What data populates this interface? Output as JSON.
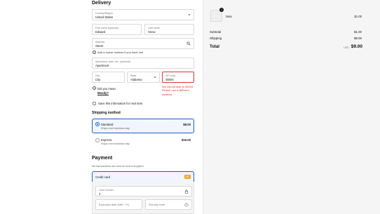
{
  "delivery": {
    "heading": "Delivery",
    "country": {
      "label": "Country/Region",
      "value": "United States"
    },
    "first_name": {
      "label": "First name (optional)",
      "value": "Edward"
    },
    "last_name": {
      "label": "Last name",
      "value": "Snow"
    },
    "address": {
      "label": "Address",
      "value": "Street"
    },
    "add_house_number": "Add a house number if you have one",
    "apartment": {
      "label": "Apartment, suite, etc. (optional)",
      "value": "Apartment"
    },
    "city": {
      "label": "City",
      "value": "City"
    },
    "state": {
      "label": "State",
      "value": "Alabama"
    },
    "zip": {
      "label": "ZIP code",
      "value": "35004"
    },
    "zip_error": "We cannot ship to 35004. Please use a different address.",
    "did_you_mean": "Did you mean",
    "suggestion": "Moody?",
    "save_info": "Save this information for next time"
  },
  "shipping": {
    "heading": "Shipping method",
    "options": [
      {
        "name": "Standard",
        "desc": "Ships next business day",
        "price": "$8.00",
        "selected": true
      },
      {
        "name": "Express",
        "desc": "Ships next business day",
        "price": "$15.00",
        "selected": false
      }
    ]
  },
  "payment": {
    "heading": "Payment",
    "subtitle": "All transactions are secure and encrypted.",
    "method": "Credit card",
    "card_number": {
      "label": "Card number",
      "value": "4"
    },
    "expiration": {
      "placeholder": "Expiration date (MM / YY)"
    },
    "security": {
      "placeholder": "Security code"
    }
  },
  "summary": {
    "item": {
      "name": "Note",
      "price": "$1.00",
      "qty": "1"
    },
    "subtotal_label": "Subtotal",
    "subtotal": "$1.00",
    "shipping_label": "Shipping",
    "shipping": "$8.00",
    "total_label": "Total",
    "currency": "USD",
    "total": "$9.00"
  },
  "colors": {
    "accent": "#1a5fd0",
    "error": "#d33333",
    "badge": "#f0a830"
  }
}
